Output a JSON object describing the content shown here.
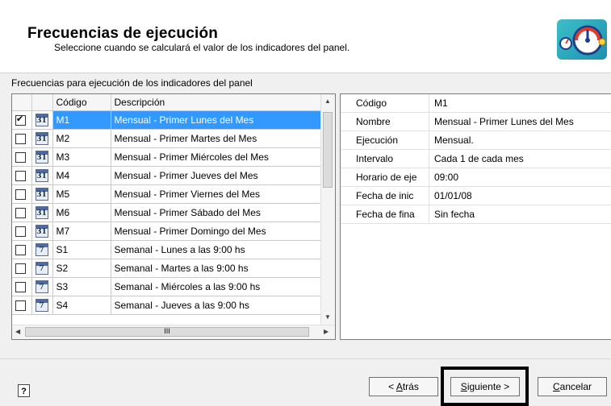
{
  "header": {
    "title": "Frecuencias de ejecución",
    "subtitle": "Seleccione cuando se calculará el valor de los indicadores del panel."
  },
  "section_label": "Frecuencias para ejecución de los indicadores del panel",
  "grid": {
    "columns": [
      "",
      "",
      "Código",
      "Descripción"
    ],
    "rows": [
      {
        "checked": true,
        "icon": "31",
        "code": "M1",
        "description": "Mensual - Primer Lunes del Mes"
      },
      {
        "checked": false,
        "icon": "31",
        "code": "M2",
        "description": "Mensual - Primer Martes del Mes"
      },
      {
        "checked": false,
        "icon": "31",
        "code": "M3",
        "description": "Mensual - Primer Miércoles del Mes"
      },
      {
        "checked": false,
        "icon": "31",
        "code": "M4",
        "description": "Mensual - Primer Jueves del Mes"
      },
      {
        "checked": false,
        "icon": "31",
        "code": "M5",
        "description": "Mensual - Primer Viernes del Mes"
      },
      {
        "checked": false,
        "icon": "31",
        "code": "M6",
        "description": "Mensual - Primer Sábado del Mes"
      },
      {
        "checked": false,
        "icon": "31",
        "code": "M7",
        "description": "Mensual - Primer Domingo del Mes"
      },
      {
        "checked": false,
        "icon": "7",
        "code": "S1",
        "description": "Semanal - Lunes a las 9:00 hs"
      },
      {
        "checked": false,
        "icon": "7",
        "code": "S2",
        "description": "Semanal - Martes a las 9:00 hs"
      },
      {
        "checked": false,
        "icon": "7",
        "code": "S3",
        "description": "Semanal - Miércoles a las 9:00 hs"
      },
      {
        "checked": false,
        "icon": "7",
        "code": "S4",
        "description": "Semanal - Jueves a las 9:00 hs"
      }
    ]
  },
  "properties": {
    "rows": [
      {
        "key": "Código",
        "value": "M1"
      },
      {
        "key": "Nombre",
        "value": "Mensual - Primer Lunes del Mes"
      },
      {
        "key": "Ejecución",
        "value": "Mensual."
      },
      {
        "key": "Intervalo",
        "value": "Cada 1 de cada mes"
      },
      {
        "key": "Horario de eje",
        "value": "09:00"
      },
      {
        "key": "Fecha de inic",
        "value": "01/01/08"
      },
      {
        "key": "Fecha de fina",
        "value": "Sin fecha"
      }
    ]
  },
  "buttons": {
    "back_prefix": "< ",
    "back_hotkey": "A",
    "back_rest": "trás",
    "next_hotkey": "S",
    "next_rest": "iguiente >",
    "cancel_hotkey": "C",
    "cancel_rest": "ancelar",
    "help": "?"
  },
  "scrollbar": {
    "h_grip": "III"
  },
  "colors": {
    "selection": "#3399ff",
    "background": "#f0f0f0"
  }
}
